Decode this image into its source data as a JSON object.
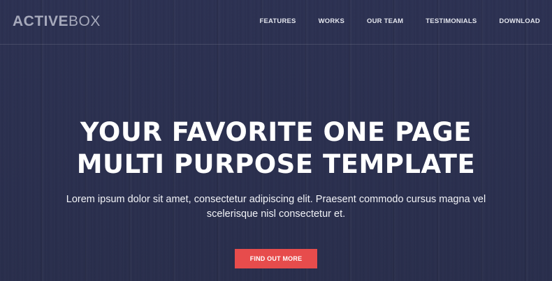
{
  "brand": {
    "logo_bold": "ACTIVE",
    "logo_light": "BOX"
  },
  "nav": {
    "items": [
      {
        "label": "FEATURES"
      },
      {
        "label": "WORKS"
      },
      {
        "label": "OUR TEAM"
      },
      {
        "label": "TESTIMONIALS"
      },
      {
        "label": "DOWNLOAD"
      }
    ]
  },
  "hero": {
    "headline_line1": "YOUR FAVORITE ONE PAGE",
    "headline_line2": "MULTI PURPOSE TEMPLATE",
    "subtitle": "Lorem ipsum dolor sit amet, consectetur adipiscing elit. Praesent commodo cursus magna vel scelerisque nisl consectetur et.",
    "cta_label": "FIND OUT MORE"
  },
  "colors": {
    "background": "#2b3050",
    "accent": "#e74c4c",
    "logo": "#a6a9bb",
    "text": "#ffffff"
  }
}
